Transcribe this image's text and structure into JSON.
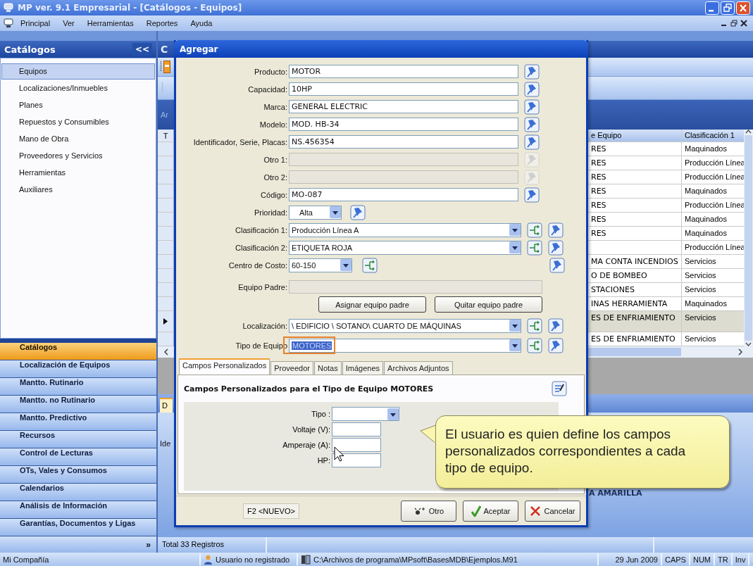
{
  "window": {
    "title": "MP ver. 9.1 Empresarial - [Catálogos - Equipos]"
  },
  "menu": [
    "Principal",
    "Ver",
    "Herramientas",
    "Reportes",
    "Ayuda"
  ],
  "sidebar": {
    "title": "Catálogos",
    "collapse": "<<",
    "items": [
      {
        "label": "Equipos",
        "selected": true
      },
      {
        "label": "Localizaciones/Inmuebles",
        "selected": false
      },
      {
        "label": "Planes",
        "selected": false
      },
      {
        "label": "Repuestos y Consumibles",
        "selected": false
      },
      {
        "label": "Mano de Obra",
        "selected": false
      },
      {
        "label": "Proveedores y Servicios",
        "selected": false
      },
      {
        "label": "Herramientas",
        "selected": false
      },
      {
        "label": "Auxiliares",
        "selected": false
      }
    ],
    "nav": [
      {
        "label": "Catálogos",
        "selected": true
      },
      {
        "label": "Localización de Equipos",
        "selected": false
      },
      {
        "label": "Mantto. Rutinario",
        "selected": false
      },
      {
        "label": "Mantto. no Rutinario",
        "selected": false
      },
      {
        "label": "Mantto. Predictivo",
        "selected": false
      },
      {
        "label": "Recursos",
        "selected": false
      },
      {
        "label": "Control de Lecturas",
        "selected": false
      },
      {
        "label": "OTs, Vales y Consumos",
        "selected": false
      },
      {
        "label": "Calendarios",
        "selected": false
      },
      {
        "label": "Análisis de Información",
        "selected": false
      },
      {
        "label": "Garantías, Documentos y Ligas",
        "selected": false
      }
    ],
    "more": "»"
  },
  "main": {
    "header": "C",
    "band_label": "Ar",
    "detail_tab": "D",
    "detail_label": "Ide",
    "detail_fragment": "A AMARILLA",
    "total": "Total 33 Registros"
  },
  "table": {
    "corner": "T",
    "columns": [
      "e Equipo",
      "Clasificación 1"
    ],
    "rows": [
      {
        "cells": [
          "RES",
          "Maquinados"
        ],
        "selected": false
      },
      {
        "cells": [
          "RES",
          "Producción Línea"
        ],
        "selected": false
      },
      {
        "cells": [
          "RES",
          "Producción Línea"
        ],
        "selected": false
      },
      {
        "cells": [
          "RES",
          "Maquinados"
        ],
        "selected": false
      },
      {
        "cells": [
          "RES",
          "Producción Línea"
        ],
        "selected": false
      },
      {
        "cells": [
          "RES",
          "Maquinados"
        ],
        "selected": false
      },
      {
        "cells": [
          "RES",
          "Maquinados"
        ],
        "selected": false
      },
      {
        "cells": [
          "",
          "Producción Línea"
        ],
        "selected": false
      },
      {
        "cells": [
          "MA CONTA INCENDIOS",
          "Servicios"
        ],
        "selected": false
      },
      {
        "cells": [
          "O DE BOMBEO",
          "Servicios"
        ],
        "selected": false
      },
      {
        "cells": [
          "STACIONES",
          "Servicios"
        ],
        "selected": false
      },
      {
        "cells": [
          "INAS HERRAMIENTA",
          "Maquinados"
        ],
        "selected": false
      },
      {
        "cells": [
          "ES DE ENFRIAMIENTO",
          "Servicios"
        ],
        "selected": true
      },
      {
        "cells": [
          "ES DE ENFRIAMIENTO",
          "Servicios"
        ],
        "selected": false
      }
    ]
  },
  "dialog": {
    "title": "Agregar",
    "fields": [
      {
        "kind": "text",
        "label": "Producto:",
        "value": "MOTOR",
        "disabled": false
      },
      {
        "kind": "text",
        "label": "Capacidad:",
        "value": "10HP",
        "disabled": false
      },
      {
        "kind": "text",
        "label": "Marca:",
        "value": "GENERAL ELECTRIC",
        "disabled": false
      },
      {
        "kind": "text",
        "label": "Modelo:",
        "value": "MOD. HB-34",
        "disabled": false
      },
      {
        "kind": "text",
        "label": "Identificador, Serie, Placas:",
        "value": "NS.456354",
        "disabled": false
      },
      {
        "kind": "text",
        "label": "Otro 1:",
        "disabled": true
      },
      {
        "kind": "text",
        "label": "Otro 2:",
        "disabled": true
      },
      {
        "kind": "text",
        "label": "Código:",
        "value": "MO-087",
        "disabled": false
      },
      {
        "kind": "priority",
        "label": "Prioridad:",
        "value": "Alta"
      },
      {
        "kind": "combo",
        "label": "Clasificación 1:",
        "value": "Producción Línea A",
        "focused": false
      },
      {
        "kind": "combo",
        "label": "Clasificación 2:",
        "value": "ETIQUETA ROJA",
        "focused": false
      },
      {
        "kind": "cost",
        "label": "Centro de Costo:",
        "value": "60-150"
      },
      {
        "kind": "parent",
        "label": "Equipo Padre:",
        "disabled": true
      },
      {
        "kind": "buttons",
        "buttons": [
          "Asignar equipo padre",
          "Quitar equipo padre"
        ]
      },
      {
        "kind": "combo",
        "label": "Localización:",
        "value": "\\ EDIFICIO \\ SOTANO\\ CUARTO DE MÁQUINAS",
        "focused": false
      },
      {
        "kind": "combo",
        "label": "Tipo de Equipo",
        "value": "MOTORES",
        "focused": true
      }
    ],
    "tabs": [
      {
        "label": "Campos Personalizados",
        "selected": true
      },
      {
        "label": "Proveedor",
        "selected": false
      },
      {
        "label": "Notas",
        "selected": false
      },
      {
        "label": "Imágenes",
        "selected": false
      },
      {
        "label": "Archivos Adjuntos",
        "selected": false
      }
    ],
    "custom": {
      "heading": "Campos Personalizados para el Tipo de Equipo MOTORES",
      "fields": [
        {
          "kind": "combo",
          "label": "Tipo :"
        },
        {
          "kind": "text",
          "label": "Voltaje (V):"
        },
        {
          "kind": "text",
          "label": "Amperaje (A):"
        },
        {
          "kind": "text",
          "label": "HP:"
        }
      ]
    },
    "hint": "F2 <NUEVO>",
    "buttons": [
      {
        "kind": "other",
        "label": "Otro"
      },
      {
        "kind": "accept",
        "label": "Aceptar"
      },
      {
        "kind": "cancel",
        "label": "Cancelar"
      }
    ]
  },
  "callout": {
    "text": "El usuario es quien define los campos personalizados correspondientes a cada tipo de equipo."
  },
  "status": {
    "company": "Mi Compañía",
    "user": "Usuario no registrado",
    "path": "C:\\Archivos de programa\\MPsoft\\BasesMDB\\Ejemplos.M91",
    "date": "29 Jun 2009",
    "indicators": [
      "CAPS",
      "NUM",
      "TR",
      "Inv"
    ]
  }
}
